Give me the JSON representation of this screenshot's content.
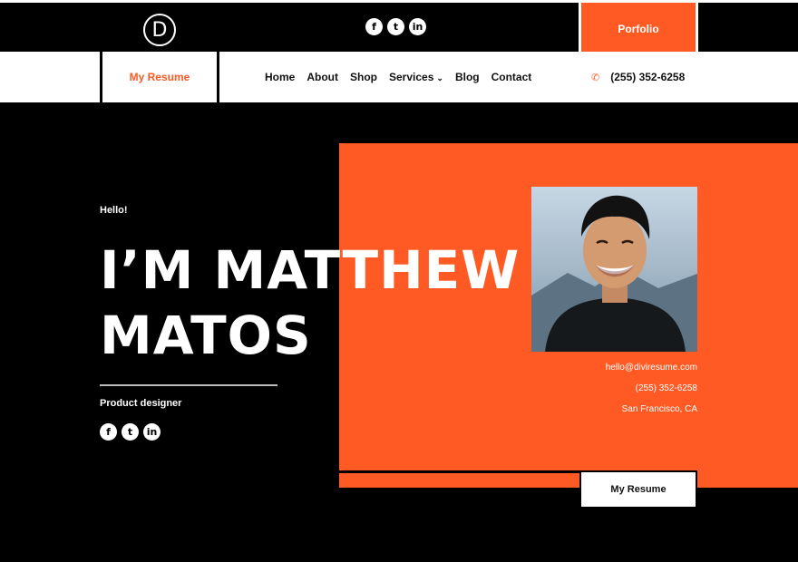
{
  "header": {
    "logo_letter": "D",
    "social_icons": [
      "facebook-icon",
      "twitter-icon",
      "linkedin-icon"
    ],
    "social_glyphs": [
      "f",
      "t",
      "in"
    ],
    "portfolio_label": "Porfolio"
  },
  "nav": {
    "resume_label": "My Resume",
    "items": [
      "Home",
      "About",
      "Shop",
      "Services",
      "Blog",
      "Contact"
    ],
    "phone": "(255) 352-6258"
  },
  "hero": {
    "greeting": "Hello!",
    "name_line1": "I’M MATTHEW",
    "name_line2": "MATOS",
    "role": "Product designer",
    "email": "hello@diviresume.com",
    "phone": "(255) 352-6258",
    "location": "San Francisco, CA",
    "resume_button": "My Resume"
  },
  "colors": {
    "accent": "#ff5a24",
    "background": "#000000",
    "nav_background": "#ffffff"
  }
}
